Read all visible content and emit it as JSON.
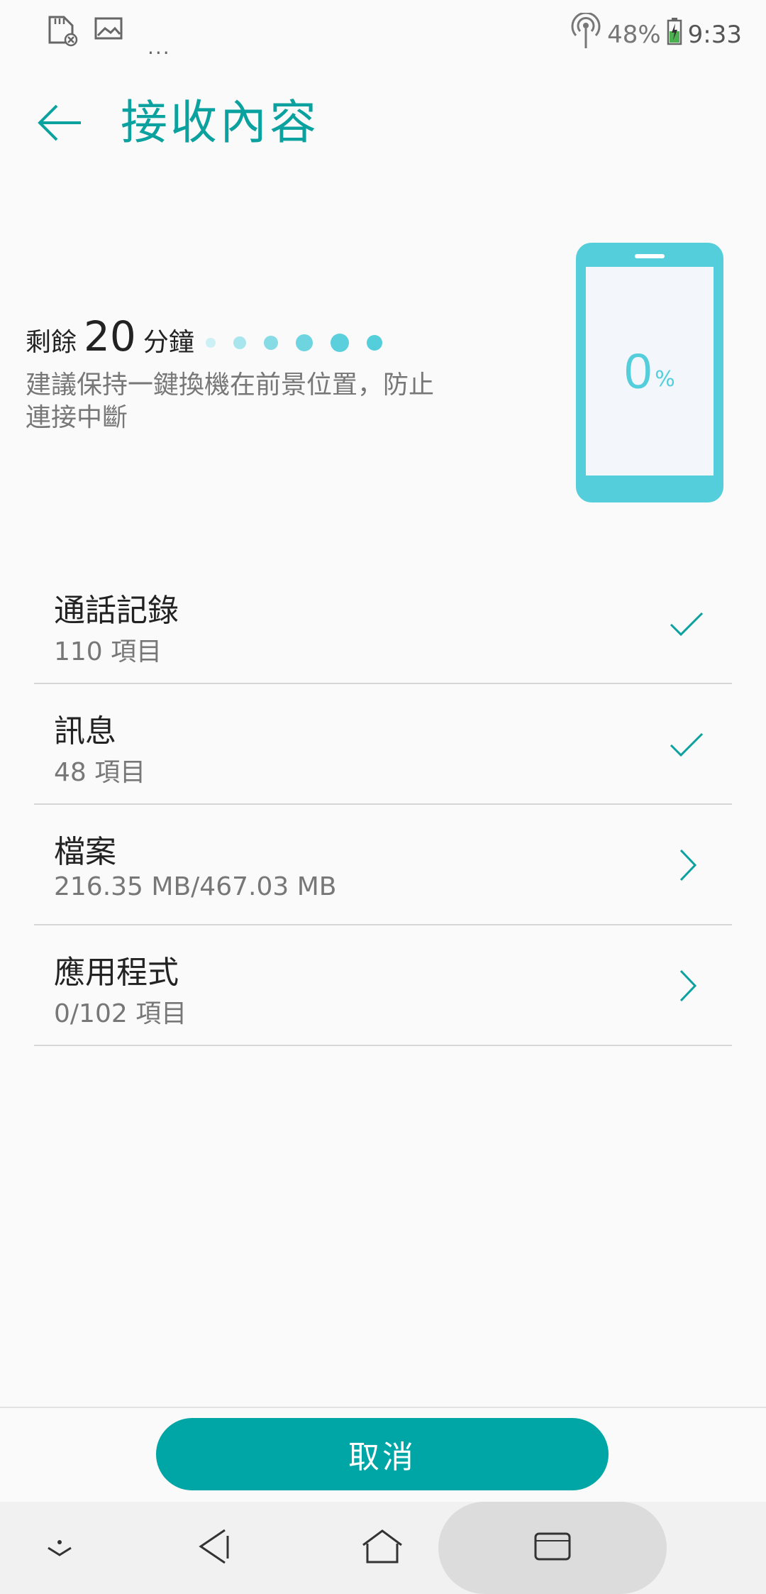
{
  "status_bar": {
    "left_icons": [
      "sd-card-icon",
      "image-icon"
    ],
    "more_indicator": "...",
    "hotspot_icon": "hotspot-icon",
    "battery_percent": "48%",
    "battery_icon": "battery-charging-icon",
    "time": "9:33"
  },
  "app_bar": {
    "back_icon": "back-arrow-icon",
    "title": "接收內容"
  },
  "transfer": {
    "remaining_prefix": "剩餘",
    "remaining_value": "20",
    "remaining_unit": "分鐘",
    "hint": "建議保持一鍵換機在前景位置，防止連接中斷",
    "progress_value": "0",
    "progress_unit": "%"
  },
  "items": [
    {
      "title": "通話記錄",
      "subtitle": "110 項目",
      "icon": "check-icon"
    },
    {
      "title": "訊息",
      "subtitle": "48 項目",
      "icon": "check-icon"
    },
    {
      "title": "檔案",
      "subtitle": "216.35 MB/467.03 MB",
      "icon": "chevron-right-icon"
    },
    {
      "title": "應用程式",
      "subtitle": "0/102 項目",
      "icon": "chevron-right-icon"
    }
  ],
  "actions": {
    "cancel_label": "取消"
  },
  "nav_bar": {
    "items": [
      "hide-nav-icon",
      "back-nav-icon",
      "home-nav-icon",
      "recents-nav-icon"
    ]
  },
  "colors": {
    "accent": "#0aa19f",
    "button": "#00a6a6",
    "phone": "#54cedb"
  }
}
